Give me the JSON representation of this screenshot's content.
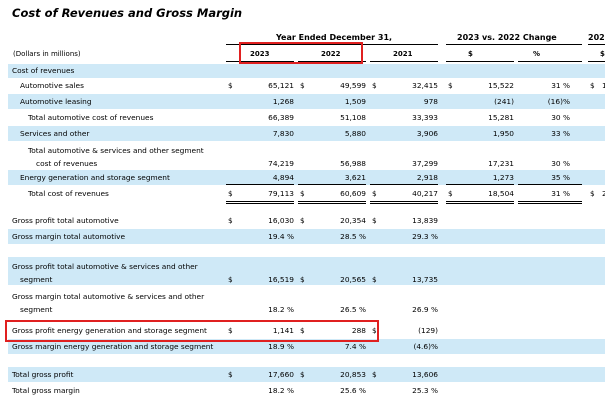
{
  "title": "Cost of Revenues and Gross Margin",
  "header": {
    "group_label": "Year Ended December 31,",
    "change_label": "2023 vs. 2022 Change",
    "next_label": "202",
    "units_label": "(Dollars in millions)",
    "years": [
      "2023",
      "2022",
      "2021"
    ],
    "change_units": [
      "$",
      "%"
    ],
    "next_unit": "$"
  },
  "rows": [
    {
      "label": "Cost of revenues",
      "band": true,
      "indent": 0,
      "values": [
        "",
        "",
        "",
        "",
        ""
      ]
    },
    {
      "label": "Automotive sales",
      "band": false,
      "indent": 8,
      "d1": "$",
      "d2": "$",
      "d3": "$",
      "d4": "$",
      "dn": "$",
      "values": [
        "65,121",
        "49,599",
        "32,415",
        "15,522",
        "31 %"
      ],
      "next": "1"
    },
    {
      "label": "Automotive leasing",
      "band": true,
      "indent": 8,
      "values": [
        "1,268",
        "1,509",
        "978",
        "(241)",
        "(16)%"
      ]
    },
    {
      "label": "Total automotive cost of revenues",
      "band": false,
      "indent": 16,
      "values": [
        "66,389",
        "51,108",
        "33,393",
        "15,281",
        "30 %"
      ],
      "next": ""
    },
    {
      "label": "Services and other",
      "band": true,
      "indent": 8,
      "values": [
        "7,830",
        "5,880",
        "3,906",
        "1,950",
        "33 %"
      ]
    },
    {
      "label1": "Total automotive & services and other segment",
      "label2": "cost of revenues",
      "band": false,
      "indent": 16,
      "values": [
        "74,219",
        "56,988",
        "37,299",
        "17,231",
        "30 %"
      ]
    },
    {
      "label": "Energy generation and storage segment",
      "band": true,
      "indent": 8,
      "values": [
        "4,894",
        "3,621",
        "2,918",
        "1,273",
        "35 %"
      ]
    },
    {
      "label": "Total cost of revenues",
      "band": false,
      "indent": 16,
      "d1": "$",
      "d2": "$",
      "d3": "$",
      "d4": "$",
      "dn": "$",
      "values": [
        "79,113",
        "60,609",
        "40,217",
        "18,504",
        "31 %"
      ],
      "next": "2"
    },
    {
      "label": "Gross profit total automotive",
      "band": false,
      "indent": 0,
      "d1": "$",
      "d2": "$",
      "d3": "$",
      "values": [
        "16,030",
        "20,354",
        "13,839",
        "",
        ""
      ]
    },
    {
      "label": "Gross margin total automotive",
      "band": true,
      "indent": 0,
      "values": [
        "19.4 %",
        "28.5 %",
        "29.3 %",
        "",
        ""
      ]
    },
    {
      "label1": "Gross profit total automotive & services and other",
      "label2": "segment",
      "band": true,
      "indent": 0,
      "d1": "$",
      "d2": "$",
      "d3": "$",
      "values": [
        "16,519",
        "20,565",
        "13,735",
        "",
        ""
      ]
    },
    {
      "label1": "Gross margin total automotive & services and other",
      "label2": "segment",
      "band": false,
      "indent": 0,
      "values": [
        "18.2 %",
        "26.5 %",
        "26.9 %",
        "",
        ""
      ]
    },
    {
      "label": "Gross profit energy generation and storage segment",
      "band": false,
      "indent": 0,
      "d1": "$",
      "d2": "$",
      "d3": "$",
      "values": [
        "1,141",
        "288",
        "(129)",
        "",
        ""
      ]
    },
    {
      "label": "Gross margin energy generation and storage segment",
      "band": true,
      "indent": 0,
      "values": [
        "18.9 %",
        "7.4 %",
        "(4.6)%",
        "",
        ""
      ]
    },
    {
      "label": "Total gross profit",
      "band": true,
      "indent": 0,
      "d1": "$",
      "d2": "$",
      "d3": "$",
      "values": [
        "17,660",
        "20,853",
        "13,606",
        "",
        ""
      ]
    },
    {
      "label": "Total gross margin",
      "band": false,
      "indent": 0,
      "values": [
        "18.2 %",
        "25.6 %",
        "25.3 %",
        "",
        ""
      ]
    }
  ],
  "highlight_colors": {
    "box": "#e02020",
    "band": "#cfe9f7"
  }
}
